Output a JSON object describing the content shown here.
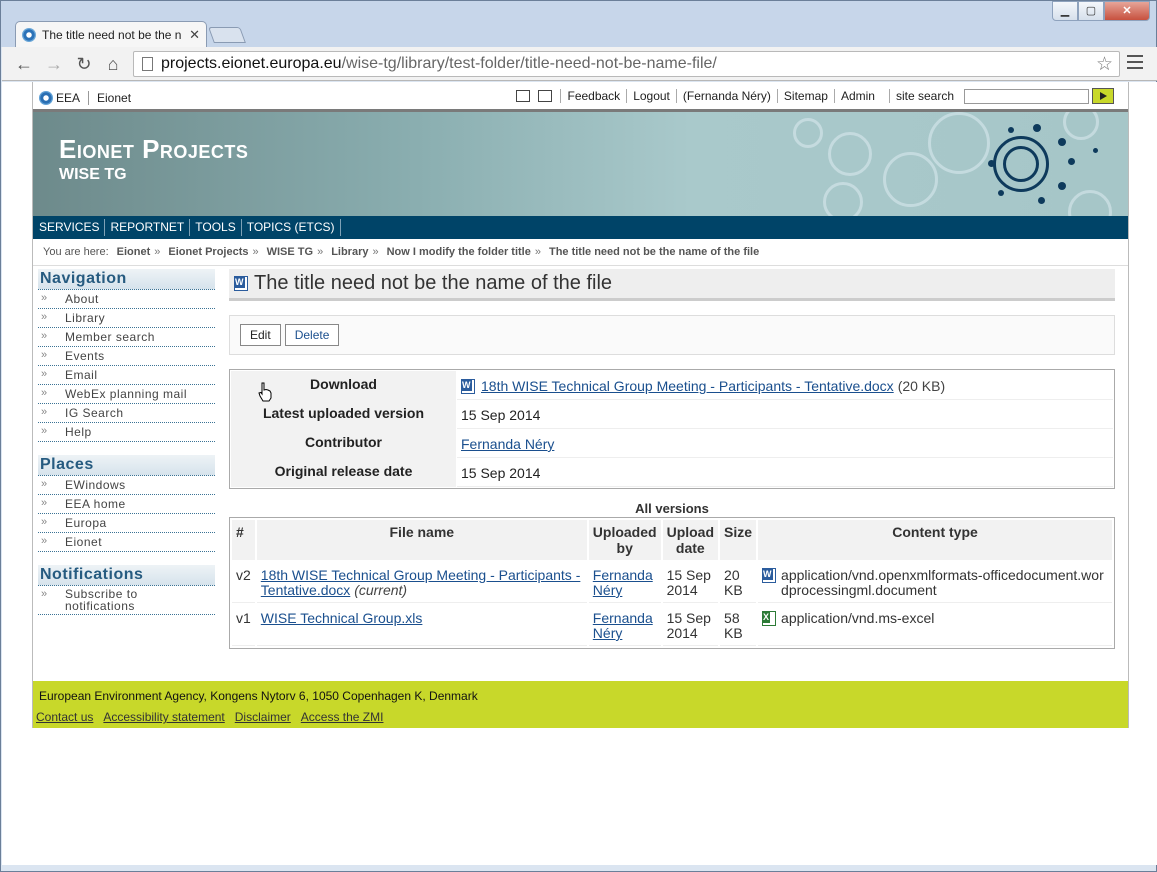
{
  "browser": {
    "tab_title": "The title need not be the n",
    "url_host": "projects.eionet.europa.eu",
    "url_path": "/wise-tg/library/test-folder/title-need-not-be-name-file/"
  },
  "toolribbon": {
    "eea": "EEA",
    "eionet": "Eionet",
    "feedback": "Feedback",
    "logout": "Logout",
    "user": "(Fernanda Néry)",
    "sitemap": "Sitemap",
    "admin": "Admin",
    "search_label": "site search"
  },
  "banner": {
    "title": "Eionet Projects",
    "subtitle": "WISE TG"
  },
  "topnav": [
    "SERVICES",
    "REPORTNET",
    "TOOLS",
    "TOPICS (ETCS)"
  ],
  "breadcrumbs": {
    "lead": "You are here:",
    "items": [
      "Eionet",
      "Eionet Projects",
      "WISE TG",
      "Library",
      "Now I modify the folder title",
      "The title need not be the name of the file"
    ]
  },
  "sidebar": {
    "navigation_title": "Navigation",
    "navigation": [
      "About",
      "Library",
      "Member search",
      "Events",
      "Email",
      "WebEx planning mail",
      "IG Search",
      "Help"
    ],
    "places_title": "Places",
    "places": [
      "EWindows",
      "EEA home",
      "Europa",
      "Eionet"
    ],
    "notifications_title": "Notifications",
    "notifications": [
      "Subscribe to notifications"
    ]
  },
  "document": {
    "title": "The title need not be the name of the file",
    "edit_label": "Edit",
    "delete_label": "Delete",
    "meta": {
      "download_label": "Download",
      "download_file": "18th WISE Technical Group Meeting - Participants - Tentative.docx",
      "download_size": "(20 KB)",
      "latest_label": "Latest uploaded version",
      "latest_value": "15 Sep 2014",
      "contributor_label": "Contributor",
      "contributor_value": "Fernanda Néry",
      "release_label": "Original release date",
      "release_value": "15 Sep 2014"
    }
  },
  "versions": {
    "caption": "All versions",
    "headers": {
      "num": "#",
      "file": "File name",
      "uploaded_by": "Uploaded by",
      "upload_date": "Upload date",
      "size": "Size",
      "content_type": "Content type"
    },
    "rows": [
      {
        "num": "v2",
        "file": "18th WISE Technical Group Meeting - Participants - Tentative.docx",
        "current": "(current)",
        "by": "Fernanda Néry",
        "date": "15 Sep 2014",
        "size": "20 KB",
        "type": "application/vnd.openxmlformats-officedocument.wordprocessingml.document",
        "icon": "word-icon"
      },
      {
        "num": "v1",
        "file": "WISE Technical Group.xls",
        "current": "",
        "by": "Fernanda Néry",
        "date": "15 Sep 2014",
        "size": "58 KB",
        "type": "application/vnd.ms-excel",
        "icon": "excel-icon"
      }
    ]
  },
  "footer": {
    "address": "European Environment Agency, Kongens Nytorv 6, 1050 Copenhagen K, Denmark",
    "links": [
      "Contact us",
      "Accessibility statement",
      "Disclaimer",
      "Access the ZMI"
    ]
  },
  "colors": {
    "nav_bar": "#004468",
    "footer": "#c8d82a",
    "link": "#1a4f8e"
  }
}
